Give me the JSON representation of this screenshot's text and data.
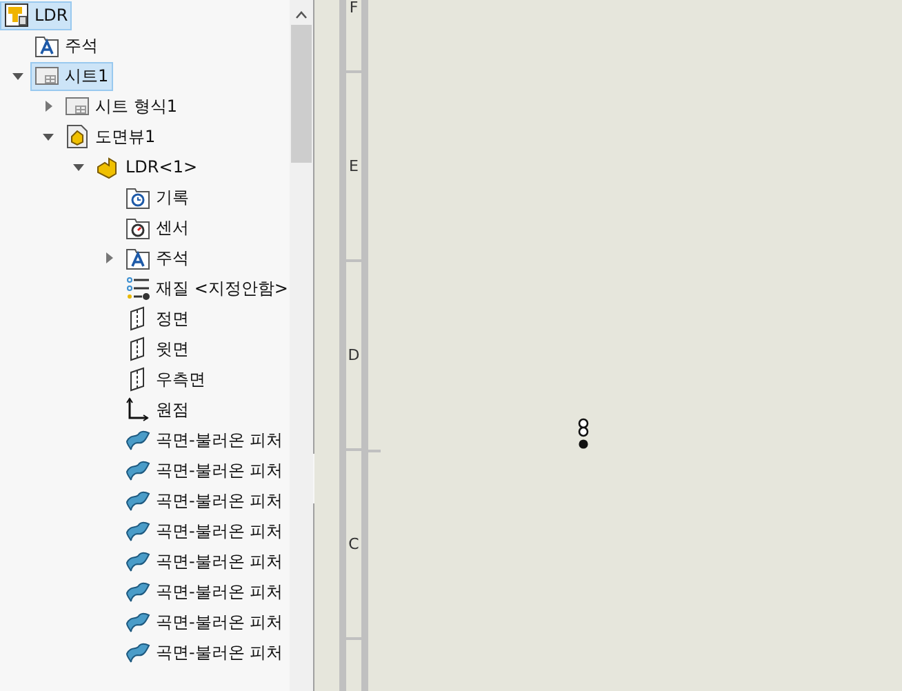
{
  "tree": [
    {
      "label": "LDR",
      "kind": "drawing",
      "selected": true,
      "children": [
        {
          "label": "주석",
          "kind": "annotation"
        },
        {
          "label": "시트1",
          "kind": "sheet",
          "selected": true,
          "expanded": true,
          "children": [
            {
              "label": "시트 형식1",
              "kind": "sheet-format",
              "expanded": false
            },
            {
              "label": "도면뷰1",
              "kind": "view",
              "expanded": true,
              "children": [
                {
                  "label": "LDR<1>",
                  "kind": "part",
                  "expanded": true,
                  "children": [
                    {
                      "label": "기록",
                      "kind": "history"
                    },
                    {
                      "label": "센서",
                      "kind": "sensor"
                    },
                    {
                      "label": "주석",
                      "kind": "annotation",
                      "expanded": false
                    },
                    {
                      "label": "재질 <지정안함>",
                      "kind": "material"
                    },
                    {
                      "label": "정면",
                      "kind": "plane"
                    },
                    {
                      "label": "윗면",
                      "kind": "plane"
                    },
                    {
                      "label": "우측면",
                      "kind": "plane"
                    },
                    {
                      "label": "원점",
                      "kind": "origin"
                    },
                    {
                      "label": "곡면-불러온 피처",
                      "kind": "surface"
                    },
                    {
                      "label": "곡면-불러온 피처",
                      "kind": "surface"
                    },
                    {
                      "label": "곡면-불러온 피처",
                      "kind": "surface"
                    },
                    {
                      "label": "곡면-불러온 피처",
                      "kind": "surface"
                    },
                    {
                      "label": "곡면-불러온 피처",
                      "kind": "surface"
                    },
                    {
                      "label": "곡면-불러온 피처",
                      "kind": "surface"
                    },
                    {
                      "label": "곡면-불러온 피처",
                      "kind": "surface"
                    },
                    {
                      "label": "곡면-불러온 피처",
                      "kind": "surface"
                    }
                  ]
                }
              ]
            }
          ]
        }
      ]
    }
  ],
  "ruler": {
    "zones": [
      "F",
      "E",
      "D",
      "C"
    ]
  }
}
